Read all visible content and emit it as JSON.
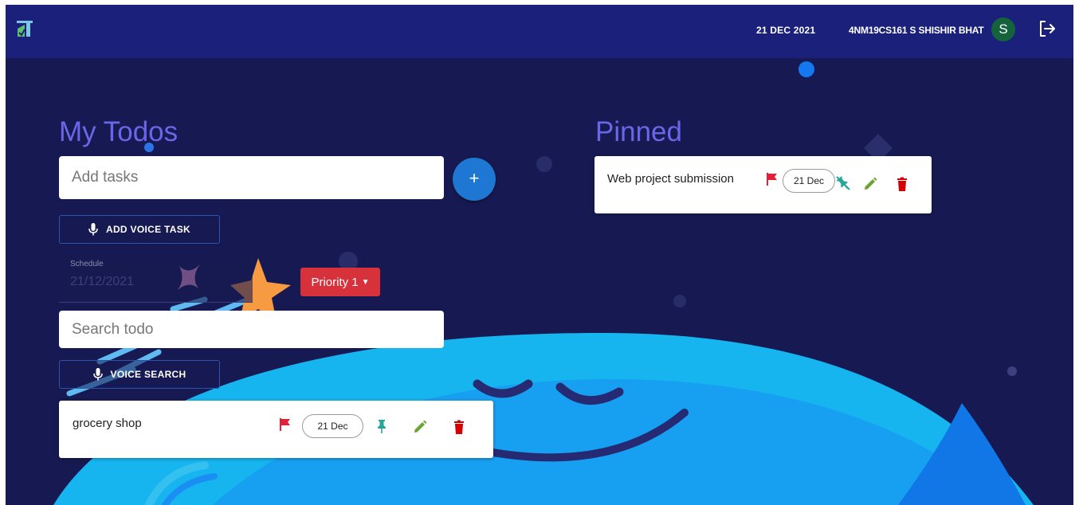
{
  "header": {
    "date": "21 DEC 2021",
    "user": "4NM19CS161 S SHISHIR BHAT",
    "avatar_letter": "S"
  },
  "todos": {
    "title": "My Todos",
    "add_placeholder": "Add tasks",
    "add_button": "+",
    "voice_task_label": "ADD VOICE TASK",
    "schedule_label": "Schedule",
    "schedule_value": "21/12/2021",
    "priority_label": "Priority 1",
    "search_placeholder": "Search todo",
    "voice_search_label": "VOICE SEARCH",
    "items": [
      {
        "text": "grocery shop",
        "date": "21 Dec",
        "pinned": false
      }
    ]
  },
  "pinned": {
    "title": "Pinned",
    "items": [
      {
        "text": "Web project submission",
        "date": "21 Dec",
        "pinned": true
      }
    ]
  },
  "colors": {
    "appbar": "#1b217a",
    "background": "#171a52",
    "heading": "#6a66e8",
    "primary": "#1e77d3",
    "priority": "#d7313c",
    "flag": "#e0213a",
    "pin": "#26a69a",
    "edit": "#6aa531",
    "delete": "#d50000"
  },
  "icons": [
    "logo-icon",
    "logout-icon",
    "mic-icon",
    "flag-icon",
    "pin-icon",
    "unpin-icon",
    "pencil-icon",
    "trash-icon"
  ]
}
